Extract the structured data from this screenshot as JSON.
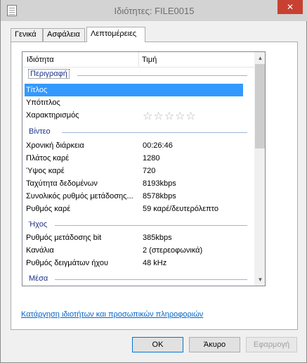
{
  "window": {
    "title": "Ιδιότητες: FILE0015",
    "close_label": "✕"
  },
  "tabs": [
    {
      "label": "Γενικά"
    },
    {
      "label": "Ασφάλεια"
    },
    {
      "label": "Λεπτομέρειες"
    }
  ],
  "list": {
    "header_property": "Ιδιότητα",
    "header_value": "Τιμή",
    "groups": {
      "description": "Περιγραφή",
      "video": "Βίντεο",
      "audio": "Ήχος",
      "media": "Μέσα"
    },
    "rows": {
      "title": {
        "name": "Τίτλος",
        "value": ""
      },
      "subtitle": {
        "name": "Υπότιτλος",
        "value": ""
      },
      "rating": {
        "name": "Χαρακτηρισμός",
        "value": "☆☆☆☆☆",
        "stars": 0,
        "max": 5
      },
      "duration": {
        "name": "Χρονική διάρκεια",
        "value": "00:26:46"
      },
      "frame_width": {
        "name": "Πλάτος καρέ",
        "value": "1280"
      },
      "frame_height": {
        "name": "Ύψος καρέ",
        "value": "720"
      },
      "data_rate": {
        "name": "Ταχύτητα δεδομένων",
        "value": "8193kbps"
      },
      "total_bitrate": {
        "name": "Συνολικός ρυθμός μετάδοσης...",
        "value": "8578kbps"
      },
      "frame_rate": {
        "name": "Ρυθμός καρέ",
        "value": "59 καρέ/δευτερόλεπτο"
      },
      "audio_bitrate": {
        "name": "Ρυθμός μετάδοσης bit",
        "value": "385kbps"
      },
      "channels": {
        "name": "Κανάλια",
        "value": "2 (στερεοφωνικά)"
      },
      "sample_rate": {
        "name": "Ρυθμός δειγμάτων ήχου",
        "value": "48 kHz"
      }
    }
  },
  "remove_link": "Κατάργηση ιδιοτήτων και προσωπικών πληροφοριών",
  "buttons": {
    "ok": "OK",
    "cancel": "Άκυρο",
    "apply": "Εφαρμογή"
  },
  "colors": {
    "selection": "#3399ff",
    "close_button": "#c84031",
    "group_text": "#1e3287",
    "link": "#0066cc"
  }
}
